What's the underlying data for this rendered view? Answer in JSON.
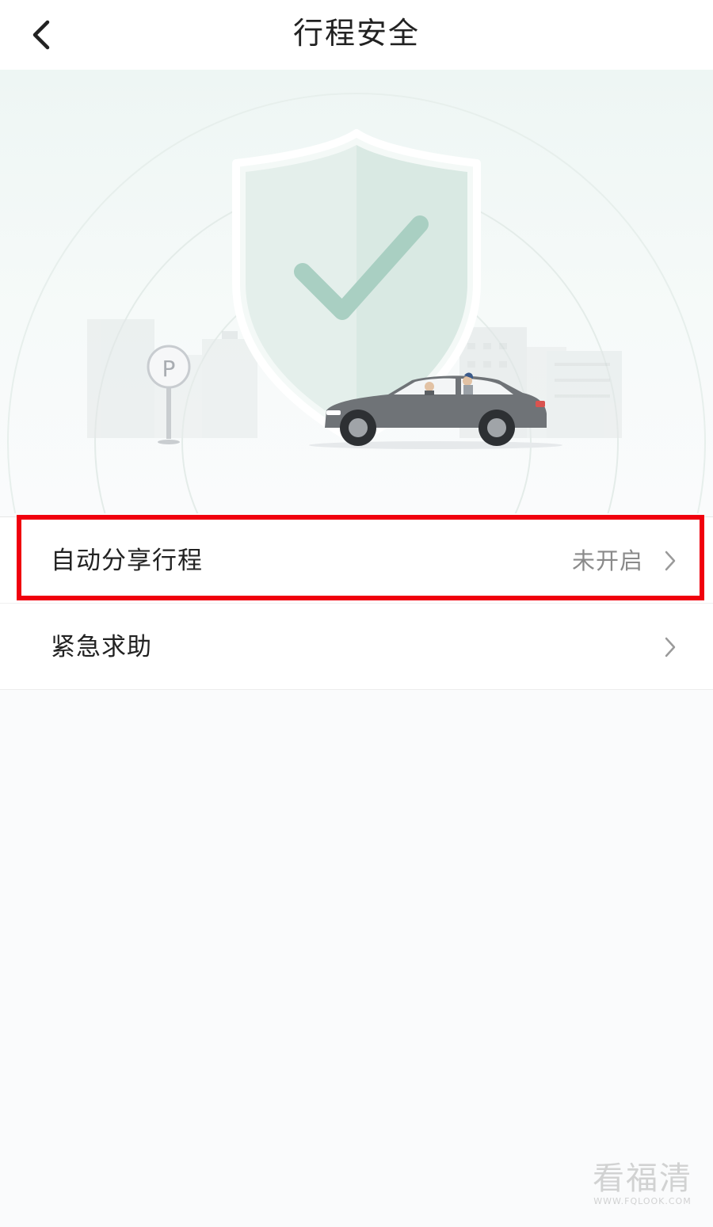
{
  "header": {
    "title": "行程安全",
    "back_icon": "chevron-left-icon"
  },
  "illustration": {
    "parking_sign_letter": "P",
    "shield_icon": "shield-check-icon"
  },
  "settings": [
    {
      "label": "自动分享行程",
      "status": "未开启",
      "icon": "chevron-right-icon"
    },
    {
      "label": "紧急求助",
      "status": "",
      "icon": "chevron-right-icon"
    }
  ],
  "watermark": {
    "text": "看福清",
    "url": "WWW.FQLOOK.COM"
  },
  "colors": {
    "highlight": "#f0000e",
    "shield": "#dcece6",
    "check": "#a9cfc2",
    "car": "#6f7377"
  }
}
